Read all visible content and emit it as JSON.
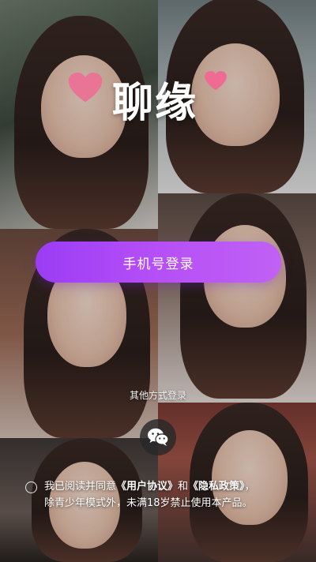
{
  "app": {
    "logo_text": "聊缘"
  },
  "login": {
    "phone_login_label": "手机号登录",
    "other_methods_label": "其他方式登录",
    "wechat_icon": "wechat-icon"
  },
  "agreement": {
    "prefix": "我已阅读并同意",
    "user_agreement": "《用户协议》",
    "and": "和",
    "privacy_policy": "《隐私政策》",
    "suffix": "，",
    "line2": "除青少年模式外，未满18岁禁止使用本产品。"
  },
  "colors": {
    "button_gradient_start": "#9b3cf5",
    "button_gradient_end": "#c061f4",
    "heart": "#f06b94"
  }
}
